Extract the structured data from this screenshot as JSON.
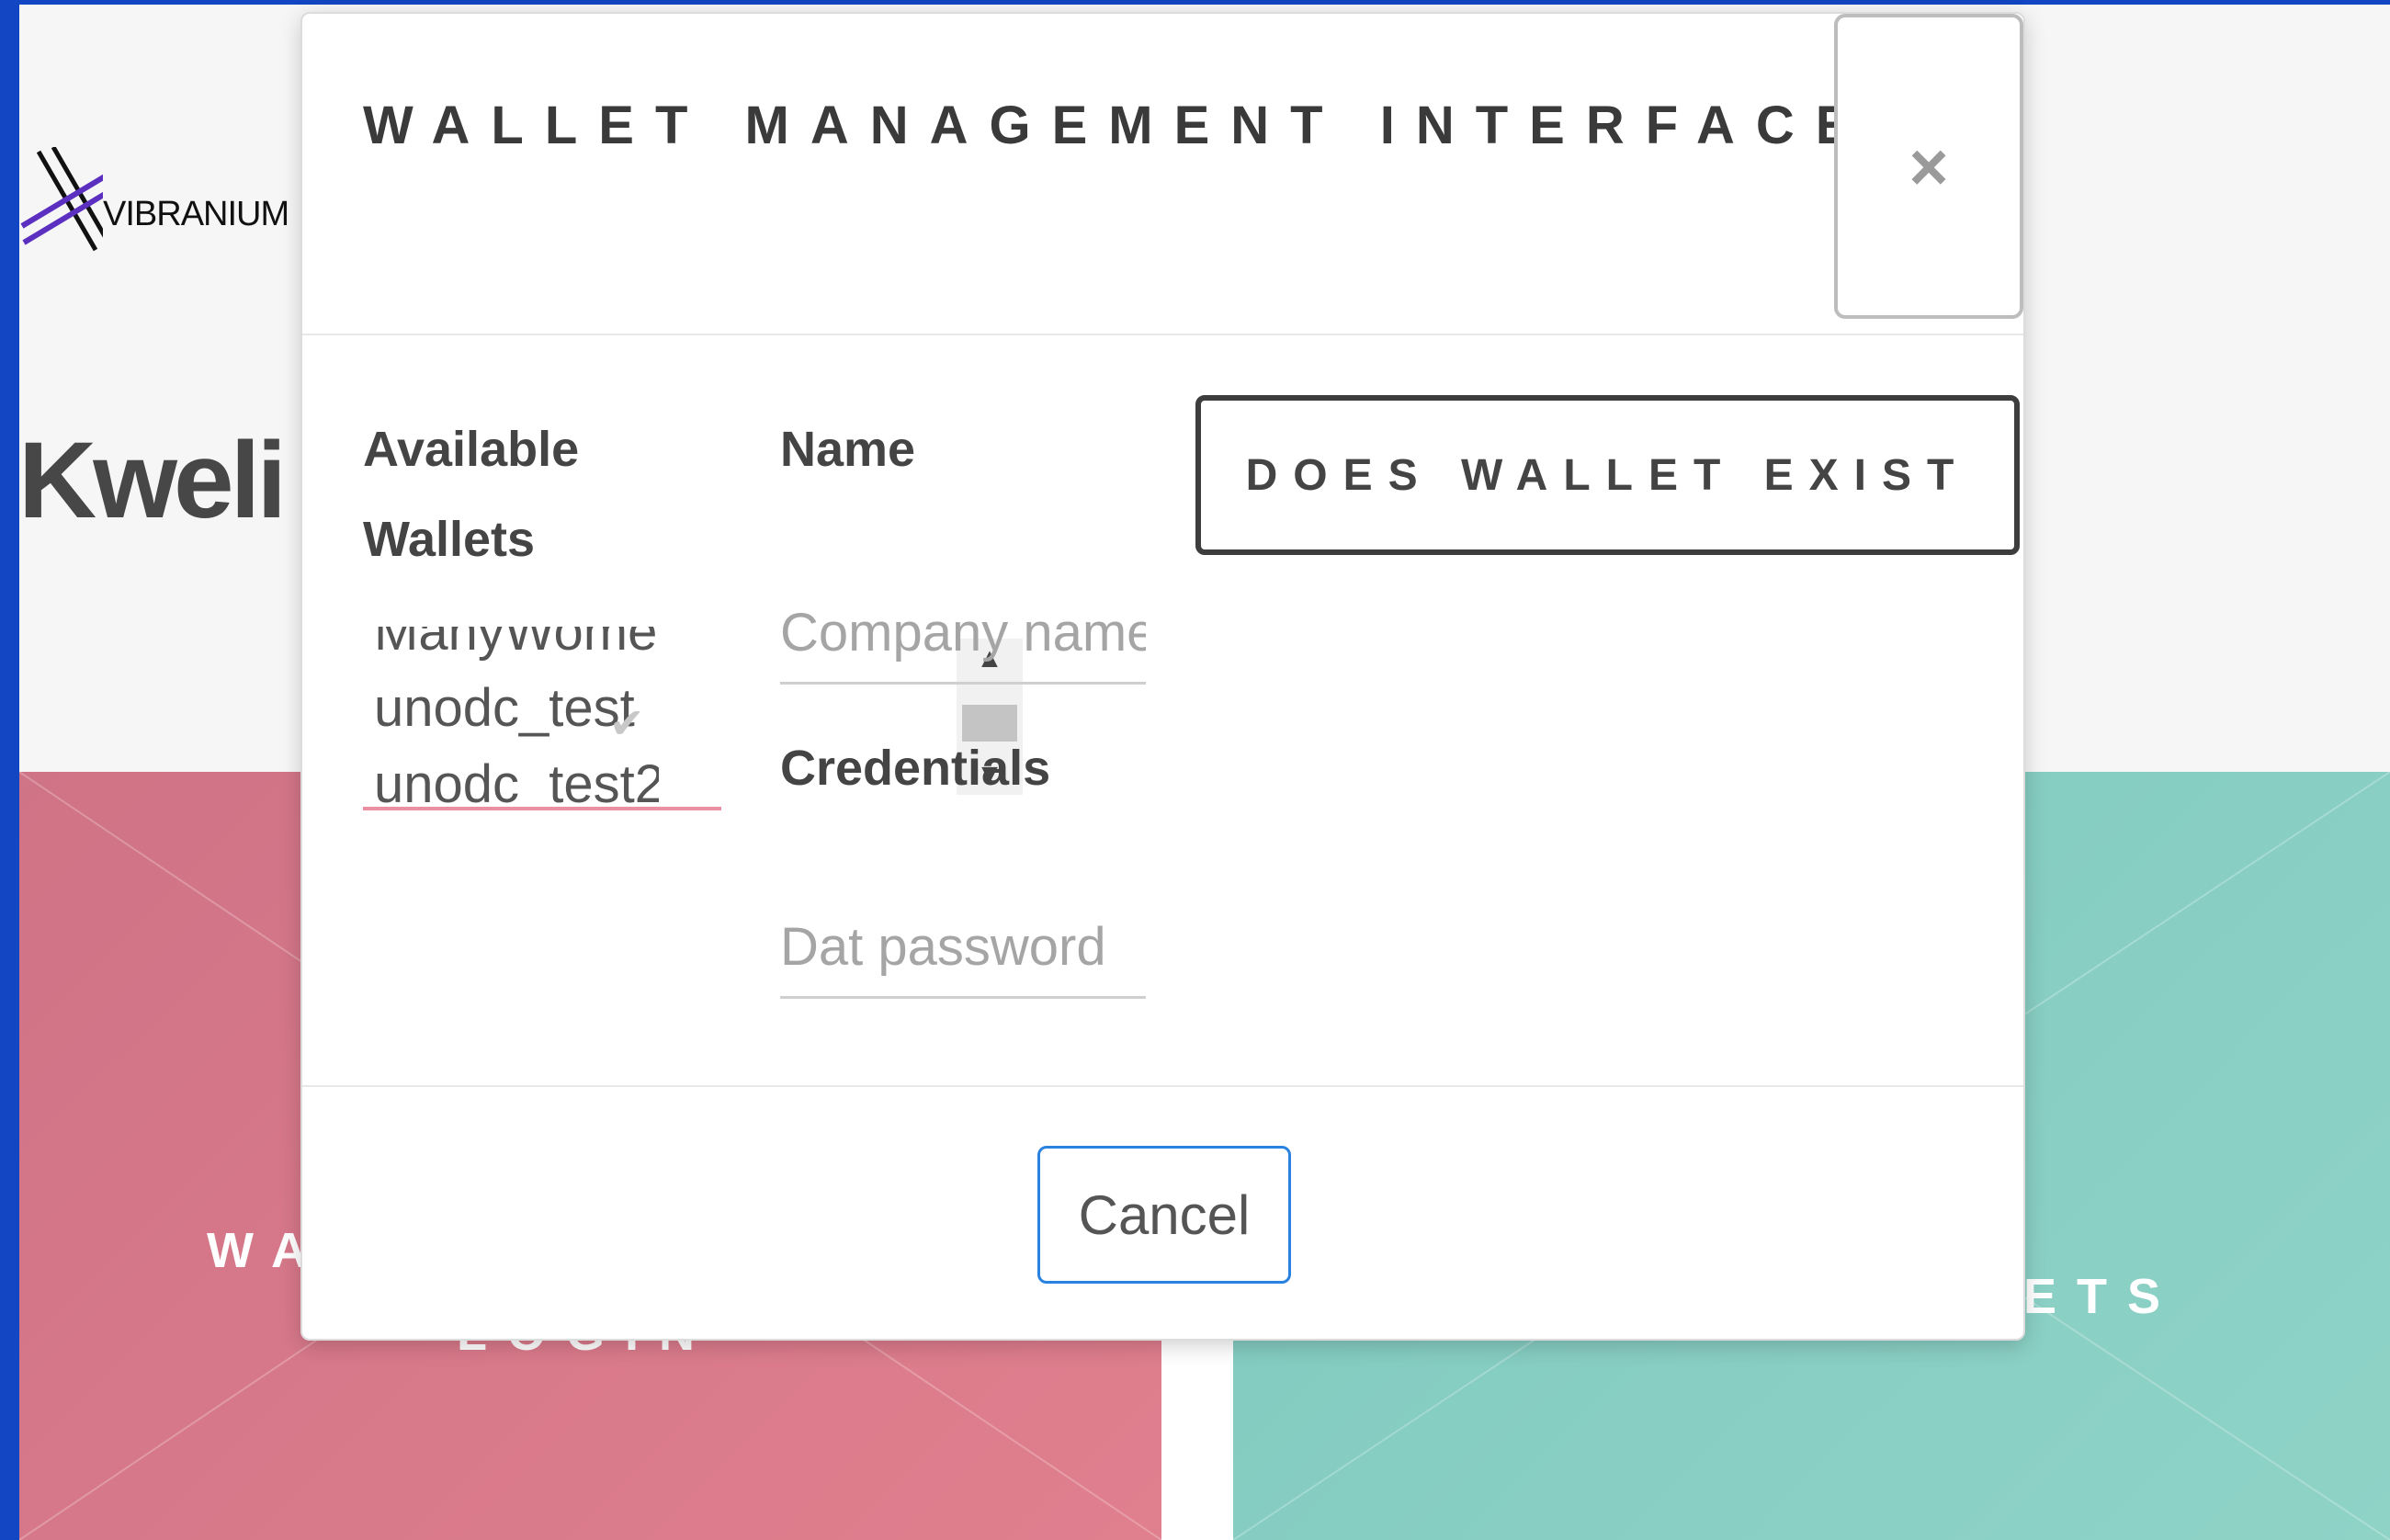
{
  "brand": {
    "logo_text": "VIBRANIUM ID",
    "name": "Kweli"
  },
  "tiles": {
    "left_label": "WA",
    "left_label_line2": "LOGIN",
    "right_label": "ETS"
  },
  "modal": {
    "title": "WALLET MANAGEMENT INTERFACE",
    "close_label": "×",
    "available_wallets_label": "Available Wallets",
    "wallets": [
      "ManyWomen",
      "unodc_test",
      "unodc_test2"
    ],
    "selected_wallet": "unodc_test",
    "name_label": "Name",
    "name_placeholder": "Company name",
    "name_value": "",
    "credentials_label": "Credentials",
    "credentials_placeholder": "Dat password",
    "credentials_value": "",
    "does_wallet_exist_label": "DOES WALLET EXIST",
    "cancel_label": "Cancel"
  },
  "colors": {
    "accent_blue": "#2a82e0",
    "pink_tile": "#e07f8e",
    "teal_tile": "#8fd3c7",
    "background_blue": "#1246c2"
  }
}
